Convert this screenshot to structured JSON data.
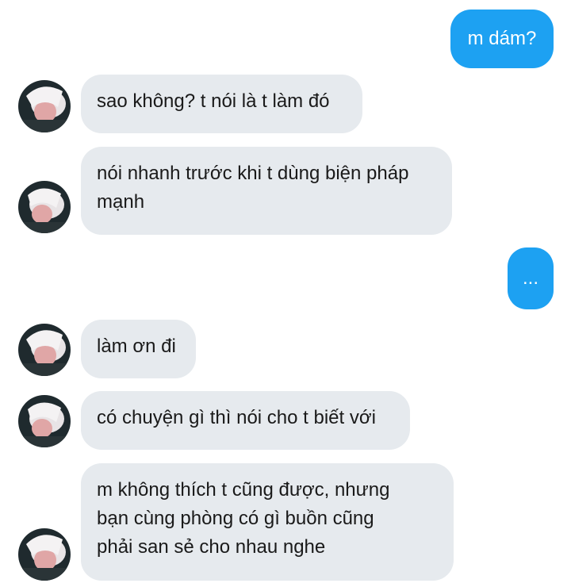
{
  "conversation": {
    "messages": [
      {
        "sender": "me",
        "text": "m dám?"
      },
      {
        "sender": "other",
        "text": "sao không? t nói là t làm đó"
      },
      {
        "sender": "other",
        "text": "nói nhanh trước khi t dùng biện pháp\nmạnh"
      },
      {
        "sender": "me",
        "text": "..."
      },
      {
        "sender": "other",
        "text": "làm ơn đi"
      },
      {
        "sender": "other",
        "text": "có chuyện gì thì nói cho t biết với"
      },
      {
        "sender": "other",
        "text": "m không thích t cũng được, nhưng\nbạn cùng phòng có gì buồn cũng\nphải san sẻ cho nhau nghe"
      }
    ]
  },
  "colors": {
    "outgoing_bubble": "#1da1f2",
    "incoming_bubble": "#e6eaee",
    "outgoing_text": "#ffffff",
    "incoming_text": "#1a1a1a"
  }
}
